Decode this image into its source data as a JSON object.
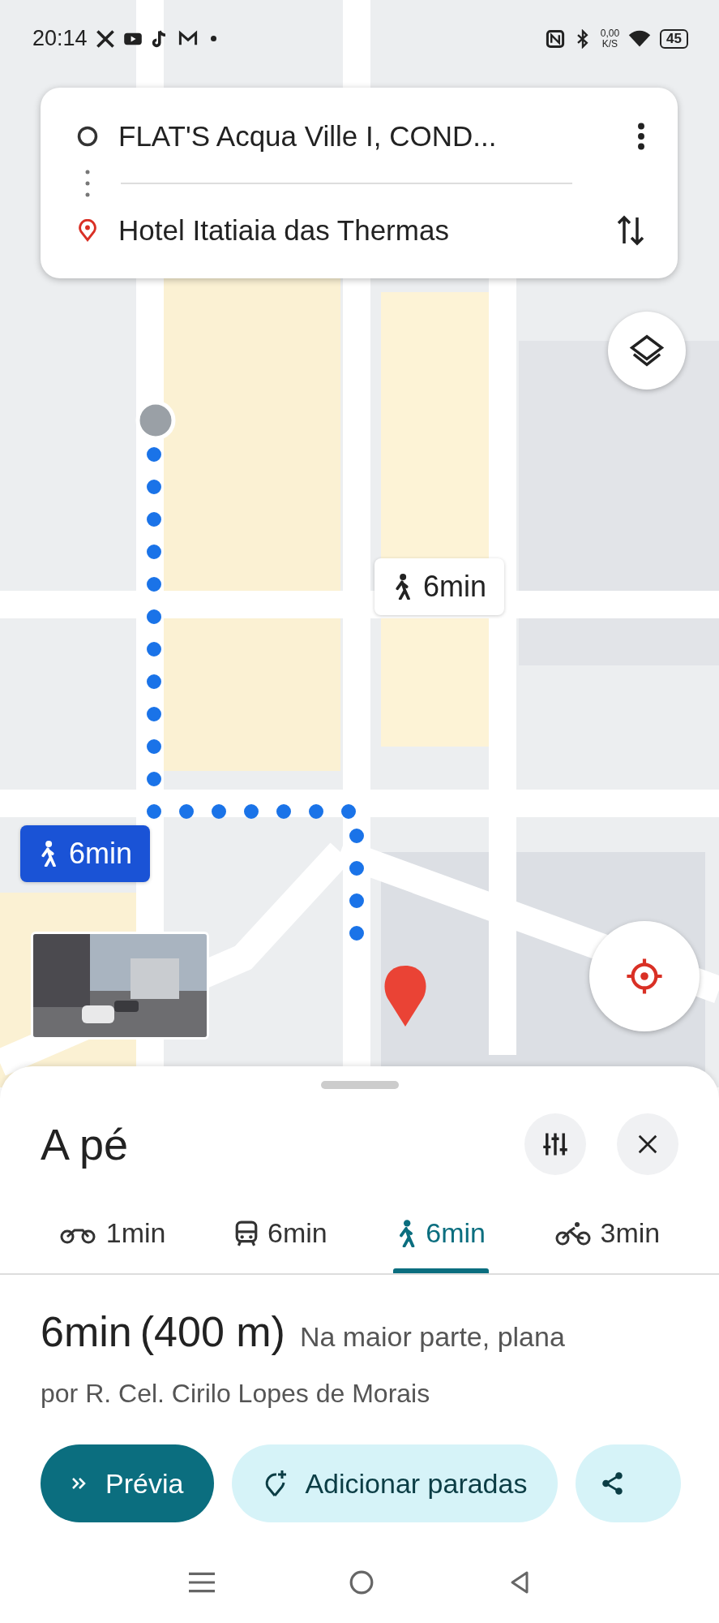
{
  "status_bar": {
    "time": "20:14",
    "speed_value": "0,00",
    "speed_unit": "K/S",
    "battery": "45"
  },
  "directions": {
    "origin": "FLAT'S Acqua Ville I, COND...",
    "destination": "Hotel Itatiaia das Thermas"
  },
  "map": {
    "kind": "picture",
    "route_labels": [
      {
        "text": "6min",
        "selected": false
      },
      {
        "text": "6min",
        "selected": true
      }
    ]
  },
  "sheet": {
    "title": "A pé",
    "modes": [
      {
        "kind": "motorcycle",
        "label": "1min",
        "selected": false
      },
      {
        "kind": "transit",
        "label": "6min",
        "selected": false
      },
      {
        "kind": "walk",
        "label": "6min",
        "selected": true
      },
      {
        "kind": "bike",
        "label": "3min",
        "selected": false
      }
    ],
    "duration": "6min",
    "distance": "(400 m)",
    "note": "Na maior parte, plana",
    "via": "por R. Cel. Cirilo Lopes de Morais",
    "actions": [
      {
        "kind": "preview",
        "label": "Prévia"
      },
      {
        "kind": "add_stops",
        "label": "Adicionar paradas"
      },
      {
        "kind": "share"
      }
    ]
  }
}
